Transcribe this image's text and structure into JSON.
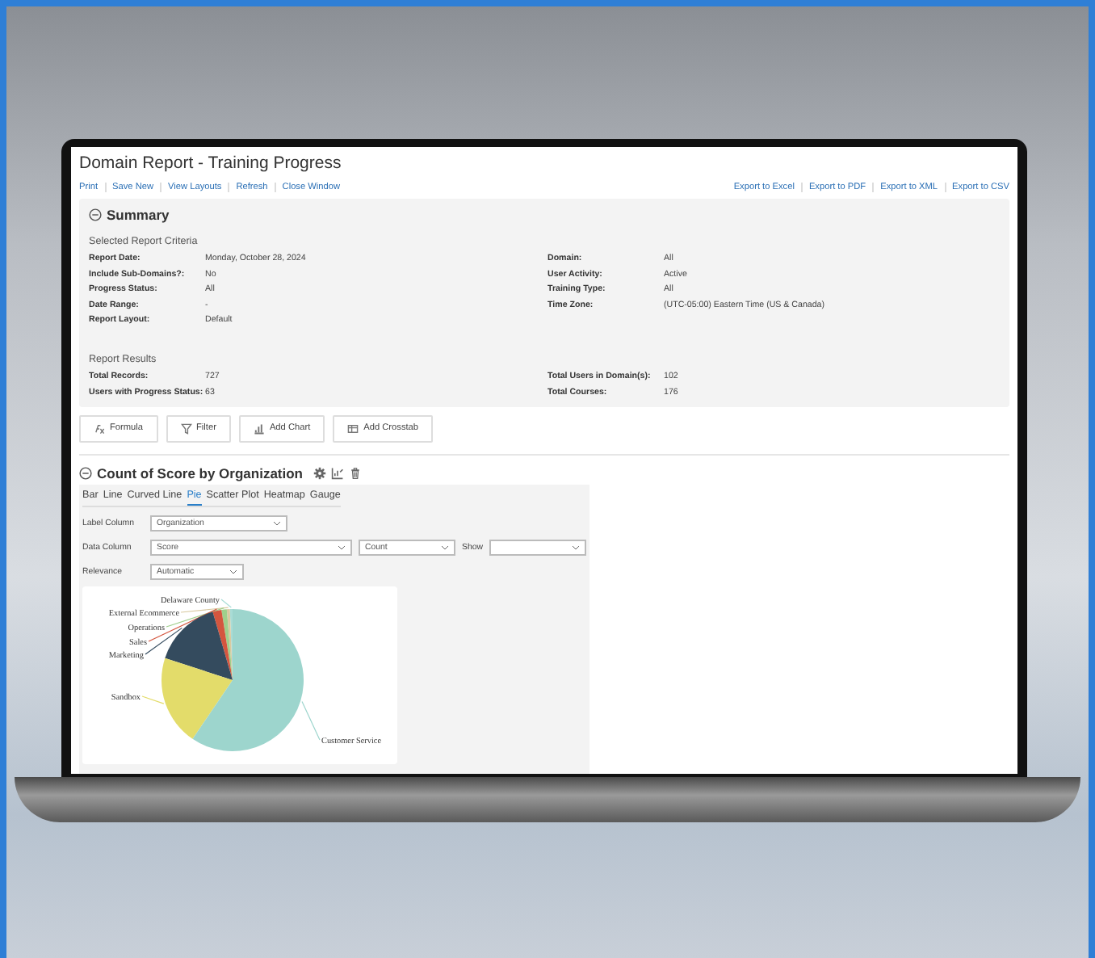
{
  "window": {
    "title": "Domain Report - Training Progress"
  },
  "actions": [
    {
      "label": "Print"
    },
    {
      "label": "Save New"
    },
    {
      "label": "View Layouts"
    },
    {
      "label": "Refresh"
    },
    {
      "label": "Close Window"
    }
  ],
  "exports": [
    {
      "label": "Export to Excel"
    },
    {
      "label": "Export to PDF"
    },
    {
      "label": "Export to XML"
    },
    {
      "label": "Export to CSV"
    }
  ],
  "summary": {
    "title": "Summary",
    "expanded": true,
    "criteria_heading": "Selected Report Criteria",
    "criteria_left": [
      {
        "label": "Report Date:",
        "value": "Monday, October 28, 2024"
      },
      {
        "label": "Include Sub-Domains?:",
        "value": "No"
      },
      {
        "label": "Progress Status:",
        "value": "All"
      },
      {
        "label": "Date Range:",
        "value": "-"
      },
      {
        "label": "Report Layout:",
        "value": "Default"
      }
    ],
    "criteria_right": [
      {
        "label": "Domain:",
        "value": "All"
      },
      {
        "label": "User Activity:",
        "value": "Active"
      },
      {
        "label": "Training Type:",
        "value": "All"
      },
      {
        "label": "Time Zone:",
        "value": "(UTC-05:00) Eastern Time (US & Canada)"
      }
    ],
    "results_heading": "Report Results",
    "results_left": [
      {
        "label": "Total Records:",
        "value": "727"
      },
      {
        "label": "Users with Progress Status:",
        "value": "63"
      }
    ],
    "results_right": [
      {
        "label": "Total Users in Domain(s):",
        "value": "102"
      },
      {
        "label": "Total Courses:",
        "value": "176"
      }
    ]
  },
  "toolbar": [
    {
      "label": "Formula",
      "kind": "formula"
    },
    {
      "label": "Filter",
      "kind": "filter"
    },
    {
      "label": "Add Chart",
      "kind": "chart"
    },
    {
      "label": "Add Crosstab",
      "kind": "crosstab"
    }
  ],
  "chart_section": {
    "title": "Count of Score by Organization",
    "expanded": true,
    "tabs": [
      {
        "label": "Bar",
        "selected": false
      },
      {
        "label": "Line",
        "selected": false
      },
      {
        "label": "Curved Line",
        "selected": false
      },
      {
        "label": "Pie",
        "selected": true
      },
      {
        "label": "Scatter Plot",
        "selected": false
      },
      {
        "label": "Heatmap",
        "selected": false
      },
      {
        "label": "Gauge",
        "selected": false
      }
    ],
    "fields": [
      {
        "label": "Label Column",
        "selects": [
          {
            "value": "Organization"
          }
        ]
      },
      {
        "label": "Data Column",
        "selects": [
          {
            "value": "Score"
          },
          {
            "value": "Count"
          },
          {
            "label": "Show"
          }
        ]
      },
      {
        "label": "Relevance",
        "selects": [
          {
            "value": "Automatic"
          }
        ]
      }
    ],
    "pie": {
      "slices": [
        {
          "label": "Delaware County",
          "color": "#a9dcd6"
        },
        {
          "label": "External Ecommerce",
          "color": "#d9c9a0"
        },
        {
          "label": "Operations",
          "color": "#9fcf8c"
        },
        {
          "label": "Sales",
          "color": "#d4563f"
        },
        {
          "label": "Marketing",
          "color": "#344b5e"
        },
        {
          "label": "Sandbox",
          "color": "#e3dc6a"
        },
        {
          "label": "Customer Service",
          "color": "#9dd5cd"
        }
      ]
    }
  }
}
